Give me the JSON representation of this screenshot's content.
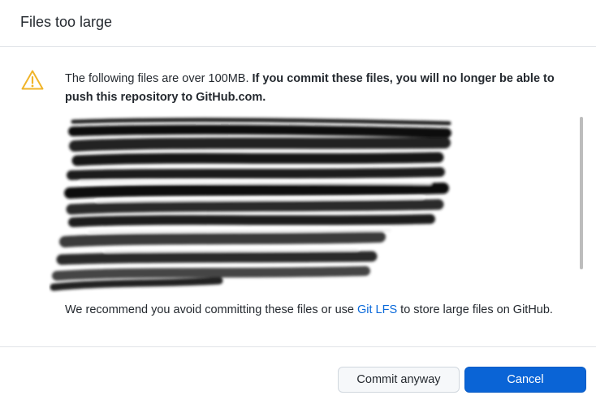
{
  "dialog": {
    "title": "Files too large",
    "message_intro": "The following files are over 100MB. ",
    "message_bold": "If you commit these files, you will no longer be able to push this repository to GitHub.com.",
    "recommend_prefix": "We recommend you avoid committing these files or use ",
    "recommend_link": "Git LFS",
    "recommend_suffix": " to store large files on GitHub.",
    "icons": {
      "warning": "warning-triangle-icon"
    },
    "colors": {
      "warning": "#f0b429",
      "link": "#0969da",
      "primary": "#0a64d6"
    }
  },
  "buttons": {
    "commit_anyway": "Commit anyway",
    "cancel": "Cancel"
  }
}
